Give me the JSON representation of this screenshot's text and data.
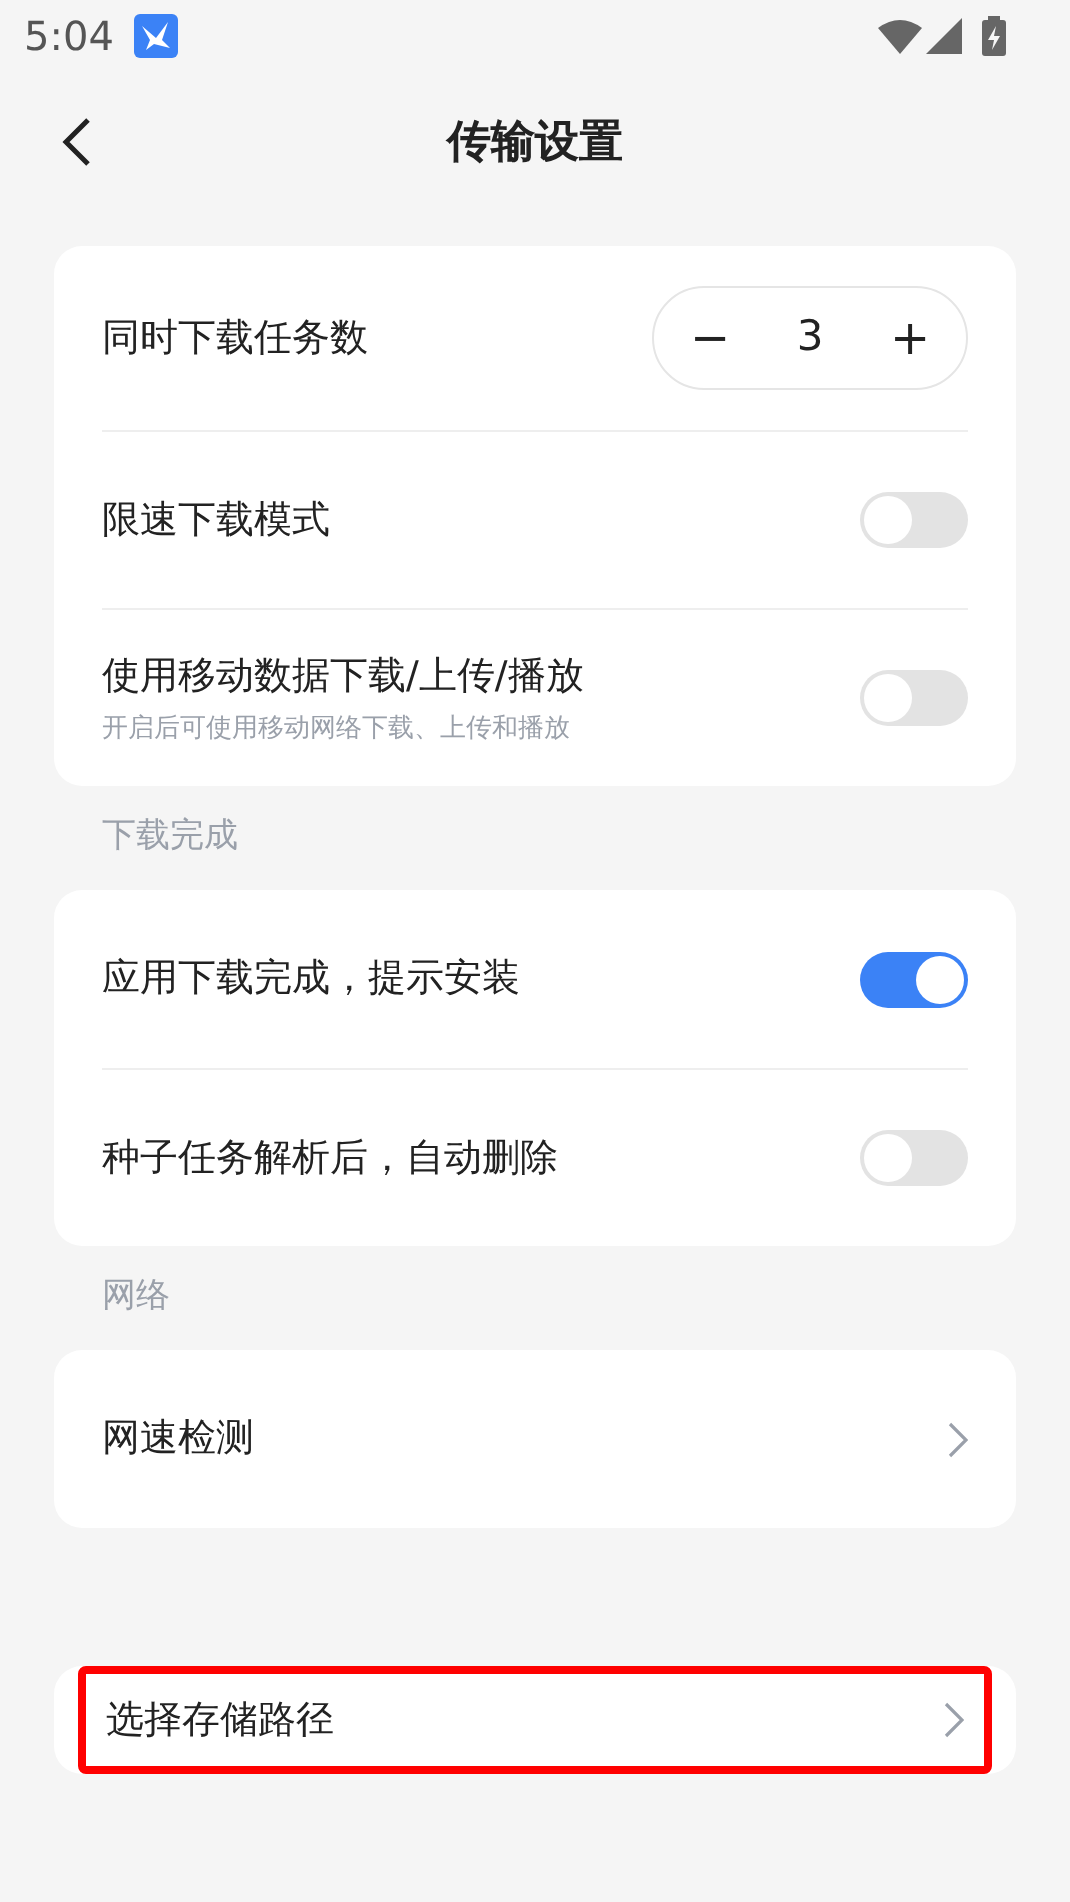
{
  "status_bar": {
    "time": "5:04"
  },
  "header": {
    "title": "传输设置"
  },
  "sections": [
    {
      "rows": [
        {
          "kind": "stepper",
          "title": "同时下载任务数",
          "minus": "−",
          "value": "3",
          "plus": "+"
        },
        {
          "kind": "toggle",
          "title": "限速下载模式",
          "on": false
        },
        {
          "kind": "toggle",
          "title": "使用移动数据下载/上传/播放",
          "subtitle": "开启后可使用移动网络下载、上传和播放",
          "on": false
        }
      ]
    },
    {
      "label": "下载完成",
      "rows": [
        {
          "kind": "toggle",
          "title": "应用下载完成，提示安装",
          "on": true
        },
        {
          "kind": "toggle",
          "title": "种子任务解析后，自动删除",
          "on": false
        }
      ]
    },
    {
      "label": "网络",
      "rows": [
        {
          "kind": "link",
          "title": "网速检测",
          "highlighted": false
        }
      ]
    },
    {
      "rows": [
        {
          "kind": "link",
          "title": "选择存储路径",
          "highlighted": true
        }
      ]
    }
  ]
}
